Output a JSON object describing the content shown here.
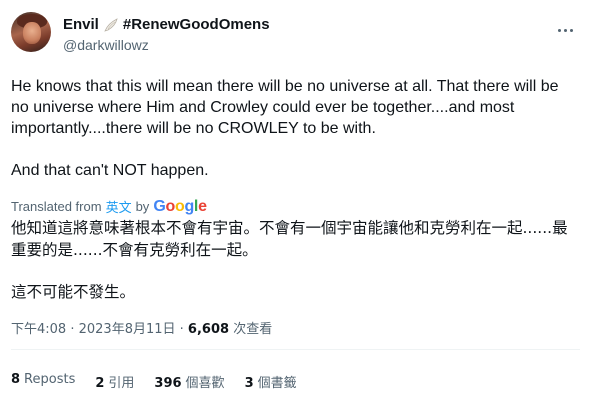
{
  "author": {
    "display_name": "Envil",
    "hashtag": "#RenewGoodOmens",
    "handle": "@darkwillowz"
  },
  "icons": {
    "avatar": "avatar-photo",
    "wing": "white-wing-emoji",
    "more": "more-horizontal-icon"
  },
  "tweet": {
    "paragraph1": "He knows that this will mean there will be no universe at all. That there will be no universe where Him and Crowley could ever be together....and most importantly....there will be no CROWLEY to be with.",
    "paragraph2": "And that can't NOT happen."
  },
  "translation": {
    "prefix": "Translated from",
    "language": "英文",
    "by": "by",
    "provider": "Google",
    "paragraph1": "他知道這將意味著根本不會有宇宙。不會有一個宇宙能讓他和克勞利在一起......最重要的是......不會有克勞利在一起。",
    "paragraph2": "這不可能不發生。"
  },
  "meta": {
    "time": "下午4:08",
    "separator": " · ",
    "date": "2023年8月11日",
    "views_count": "6,608",
    "views_label": "次查看"
  },
  "stats": [
    {
      "count": "8",
      "label": "Reposts"
    },
    {
      "count": "2",
      "label": "引用"
    },
    {
      "count": "396",
      "label": "個喜歡"
    },
    {
      "count": "3",
      "label": "個書籤"
    }
  ]
}
